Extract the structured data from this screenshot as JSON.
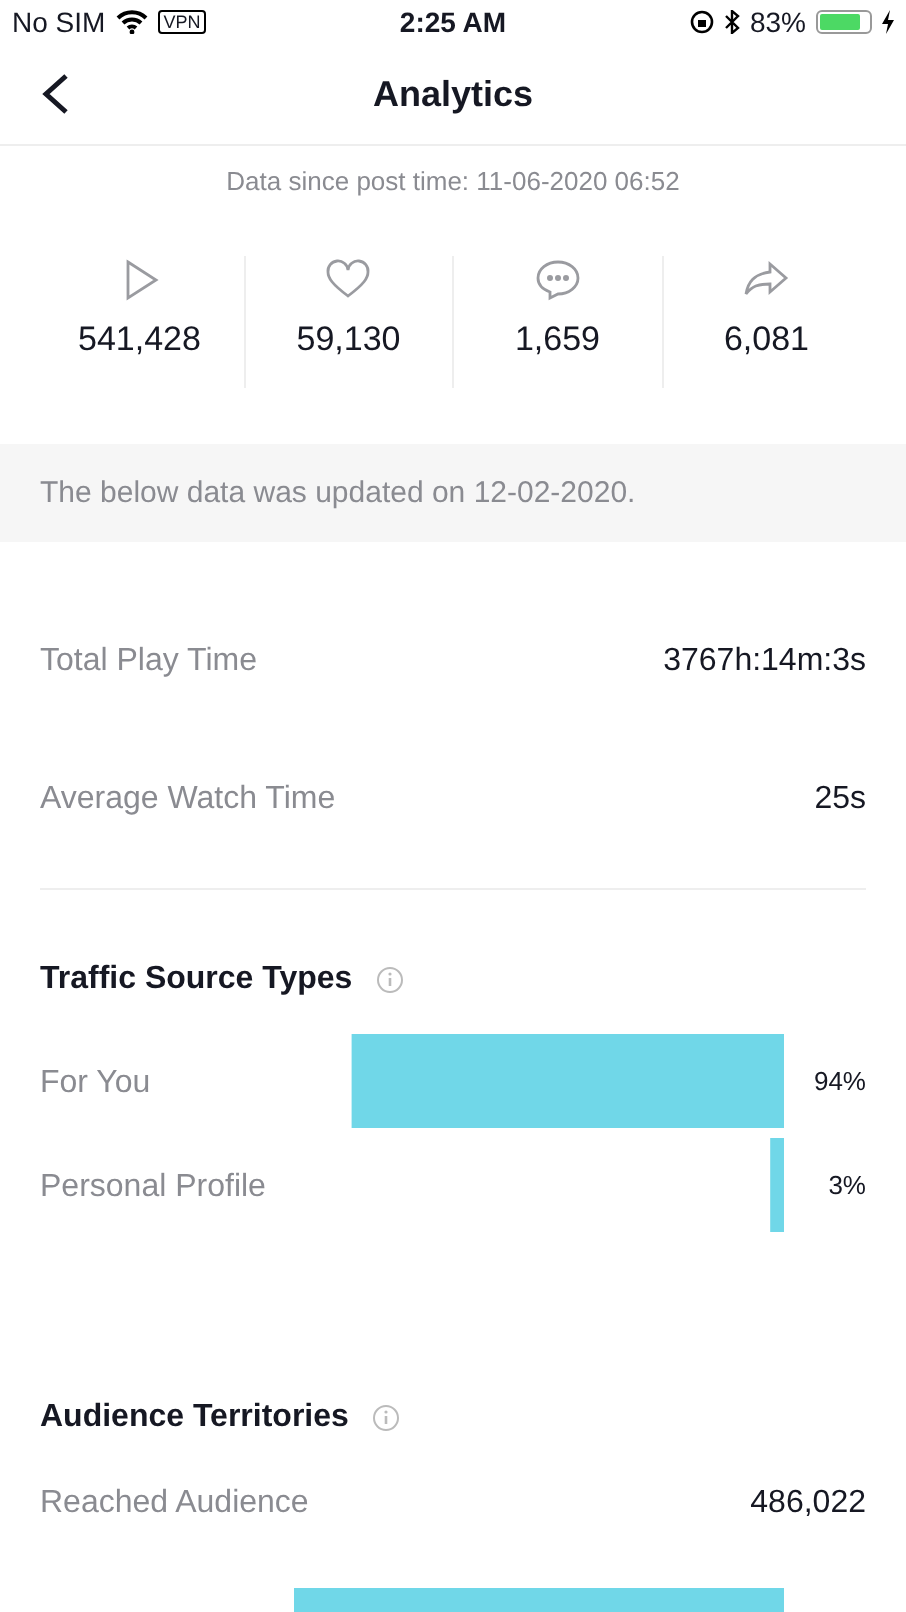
{
  "status_bar": {
    "carrier": "No SIM",
    "vpn": "VPN",
    "time": "2:25 AM",
    "battery": "83%"
  },
  "nav": {
    "title": "Analytics"
  },
  "since": "Data since post time: 11-06-2020 06:52",
  "stats": [
    {
      "kind": "play",
      "value": "541,428"
    },
    {
      "kind": "like",
      "value": "59,130"
    },
    {
      "kind": "comment",
      "value": "1,659"
    },
    {
      "kind": "share",
      "value": "6,081"
    }
  ],
  "notice": "The below data was updated on 12-02-2020.",
  "metrics": [
    {
      "label": "Total Play Time",
      "value": "3767h:14m:3s"
    },
    {
      "label": "Average Watch Time",
      "value": "25s"
    }
  ],
  "traffic": {
    "title": "Traffic Source Types",
    "chart_data": {
      "type": "bar",
      "orientation": "horizontal",
      "categories": [
        "For You",
        "Personal Profile"
      ],
      "values": [
        94,
        3
      ],
      "value_labels": [
        "94%",
        "3%"
      ]
    }
  },
  "territories": {
    "title": "Audience Territories",
    "reached_label": "Reached Audience",
    "reached_value": "486,022"
  }
}
